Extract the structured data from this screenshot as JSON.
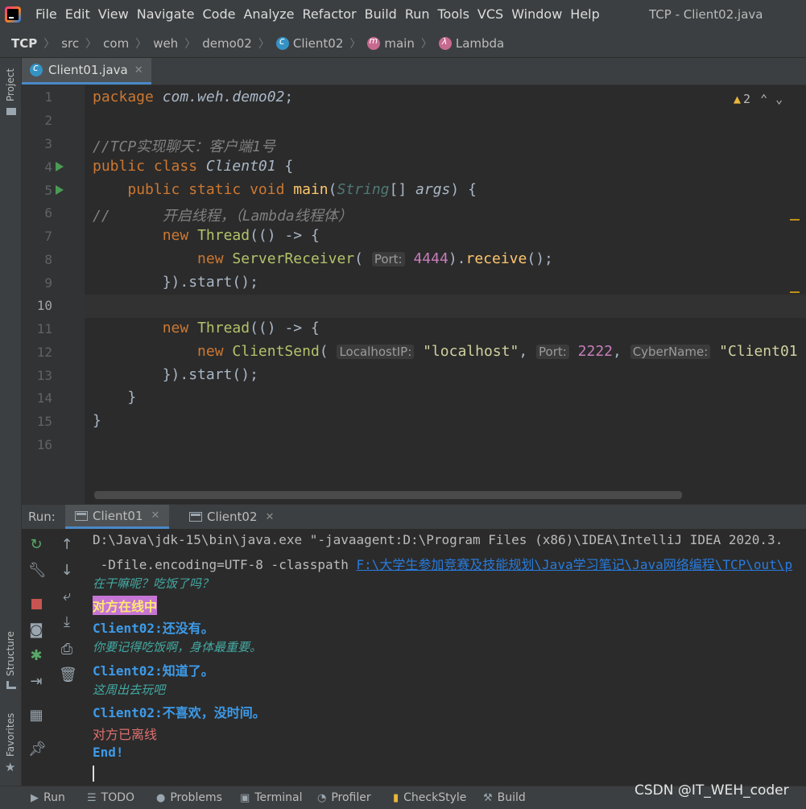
{
  "window": {
    "title": "TCP - Client02.java",
    "menus": [
      "File",
      "Edit",
      "View",
      "Navigate",
      "Code",
      "Analyze",
      "Refactor",
      "Build",
      "Run",
      "Tools",
      "VCS",
      "Window",
      "Help"
    ]
  },
  "breadcrumb": [
    "TCP",
    "src",
    "com",
    "weh",
    "demo02",
    "Client02",
    "main",
    "Lambda"
  ],
  "side_labels": {
    "project": "Project",
    "structure": "Structure",
    "favorites": "Favorites"
  },
  "editor": {
    "tab": "Client01.java",
    "warnings": "2",
    "line_numbers": [
      "1",
      "2",
      "3",
      "4",
      "5",
      "6",
      "7",
      "8",
      "9",
      "10",
      "11",
      "12",
      "13",
      "14",
      "15",
      "16"
    ],
    "code": {
      "l1_kw": "package",
      "l1_pkg": "com.weh.demo02",
      "l3": "//TCP实现聊天：客户端1号",
      "l4_kw": "public class",
      "l4_cls": "Client01",
      "l5_kw": "public static void",
      "l5_fn": "main",
      "l5_type": "String",
      "l5_param": "args",
      "l6_slash": "//",
      "l6_cmt": "开启线程，（Lambda线程体）",
      "l7_new": "new",
      "l7_cls": "Thread",
      "l8_new": "new",
      "l8_cls": "ServerReceiver",
      "l8_hint": "Port:",
      "l8_num": "4444",
      "l8_fn": "receive",
      "l9": "}).start();",
      "l11_new": "new",
      "l11_cls": "Thread",
      "l12_new": "new",
      "l12_cls": "ClientSend",
      "l12_hint1": "LocalhostIP:",
      "l12_str1": "\"localhost\"",
      "l12_hint2": "Port:",
      "l12_num": "2222",
      "l12_hint3": "CyberName:",
      "l12_str2": "\"Client01",
      "l13": "}).start();",
      "l14": "}",
      "l15": "}"
    }
  },
  "run_panel": {
    "label": "Run:",
    "tabs": [
      "Client01",
      "Client02"
    ],
    "console": {
      "cmd1": "D:\\Java\\jdk-15\\bin\\java.exe \"-javaagent:D:\\Program Files (x86)\\IDEA\\IntelliJ IDEA 2020.3.",
      "cmd2_prefix": " -Dfile.encoding=UTF-8 -classpath ",
      "cmd2_link": "F:\\大学生参加竞赛及技能规划\\Java学习笔记\\Java网络编程\\TCP\\out\\p",
      "in1": "在干嘛呢？吃饭了吗？",
      "online": "对方在线中",
      "recv1": "Client02:还没有。",
      "in2": "你要记得吃饭啊，身体最重要。",
      "recv2": "Client02:知道了。",
      "in3": "这周出去玩吧",
      "recv3": "Client02:不喜欢，没时间。",
      "offline": "对方已离线",
      "end": "End!"
    }
  },
  "bottom_tabs": [
    "Run",
    "TODO",
    "Problems",
    "Terminal",
    "Profiler",
    "CheckStyle",
    "Build"
  ],
  "watermark": "CSDN @IT_WEH_coder"
}
